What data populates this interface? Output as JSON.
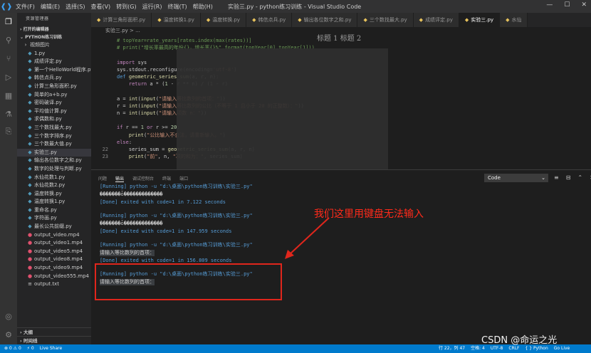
{
  "titlebar": {
    "menu": [
      "文件(F)",
      "编辑(E)",
      "选择(S)",
      "查看(V)",
      "转到(G)",
      "运行(R)",
      "终端(T)",
      "帮助(H)"
    ],
    "title": "实验三.py - python练习训练 - Visual Studio Code"
  },
  "sidebar": {
    "header": "资源管理器",
    "open_editors": "打开的编辑器",
    "folder": "PYTHON练习训练",
    "files": [
      "视频图片",
      "1.py",
      "成绩评定.py",
      "第一个HelloWorld程序.py",
      "韩信点兵.py",
      "计算三角形面积.py",
      "简单的a+b.py",
      "密码破译.py",
      "平均值计算.py",
      "求偶数和.py",
      "三个数找最大.py",
      "三个数字排序.py",
      "三个数最大值.py",
      "实验三.py",
      "输出各位数字之和.py",
      "数字的处理与判断.py",
      "水仙花数1.py",
      "水仙花数2.py",
      "温度转换.py",
      "温度转换1.py",
      "重命名.py",
      "字符画.py",
      "最长公共前缀.py",
      "output_video.mp4",
      "output_video1.mp4",
      "output_video5.mp4",
      "output_video8.mp4",
      "output_video9.mp4",
      "output_video555.mp4",
      "output.txt"
    ],
    "outline": "大纲",
    "timeline": "时间线"
  },
  "tabs": [
    "计算三角形面积.py",
    "温度转换1.py",
    "温度转换.py",
    "韩信点兵.py",
    "输出各位数字之和.py",
    "三个数找最大.py",
    "成绩评定.py",
    "实验三.py",
    "水仙"
  ],
  "breadcrumb": "实验三.py > ...",
  "overlay_tabs": "标题 1   标题 2",
  "editor": {
    "lines": [
      {
        "n": "",
        "code": "# topYear=rate_years[rates.index(max(rates))]"
      },
      {
        "n": "",
        "code": "# print(\"增长率最高的年份{}，增长率{}%\".format(topYear[0],topYear[1]))"
      },
      {
        "n": "",
        "code": ""
      },
      {
        "n": "",
        "code": "import sys"
      },
      {
        "n": "",
        "code": "sys.stdout.reconfigure(encoding='utf-8')"
      },
      {
        "n": "",
        "code": "def geometric_series_sum(a, r, n):"
      },
      {
        "n": "",
        "code": "    return a * (1 - r ** n) / (1 - r)"
      },
      {
        "n": "",
        "code": ""
      },
      {
        "n": "",
        "code": "a = int(input(\"请输入等比数列的首项：\"))"
      },
      {
        "n": "",
        "code": "r = int(input(\"请输入等比数列的公比（不等于 1 且小于 20 的正整数）：\"))"
      },
      {
        "n": "",
        "code": "n = int(input(\"请输入项数 n：\"))"
      },
      {
        "n": "",
        "code": ""
      },
      {
        "n": "",
        "code": "if r == 1 or r >= 20:"
      },
      {
        "n": "",
        "code": "    print(\"公比输入不合法，请重新输入。\")"
      },
      {
        "n": "",
        "code": "else:"
      },
      {
        "n": "22",
        "code": "    series_sum = geometric_series_sum(a, r, n)"
      },
      {
        "n": "23",
        "code": "    print(\"前\", n, \"项的和为：\", series_sum)"
      }
    ]
  },
  "panel": {
    "tabs": [
      "问题",
      "输出",
      "调试控制台",
      "终端",
      "端口"
    ],
    "active_tab": "输出",
    "select": "Code",
    "output": [
      {
        "kind": "run",
        "text": "[Running] python -u \"d:\\桌面\\python练习训练\\实验三.py\""
      },
      {
        "kind": "txt",
        "text": "�������ȱ�������������"
      },
      {
        "kind": "done",
        "text": "[Done] exited with code=1 in 7.122 seconds"
      },
      {
        "kind": "blank",
        "text": ""
      },
      {
        "kind": "run",
        "text": "[Running] python -u \"d:\\桌面\\python练习训练\\实验三.py\""
      },
      {
        "kind": "txt",
        "text": "�������ȱ�������������"
      },
      {
        "kind": "done",
        "text": "[Done] exited with code=1 in 147.959 seconds"
      },
      {
        "kind": "blank",
        "text": ""
      },
      {
        "kind": "run",
        "text": "[Running] python -u \"d:\\桌面\\python练习训练\\实验三.py\""
      },
      {
        "kind": "txt",
        "text": "请输入等比数列的首项："
      },
      {
        "kind": "done",
        "text": "[Done] exited with code=1 in 156.809 seconds"
      },
      {
        "kind": "blank",
        "text": ""
      },
      {
        "kind": "run",
        "text": "[Running] python -u \"d:\\桌面\\python练习训练\\实验三.py\""
      },
      {
        "kind": "txt",
        "text": "请输入等比数列的首项："
      }
    ]
  },
  "annotation": {
    "text": "我们这里用键盘无法输入",
    "color": "#ff2a1a"
  },
  "statusbar": {
    "left": [
      "⊗ 0 ⚠ 0",
      "⚡ 0",
      "Live Share"
    ],
    "right": [
      "行 22，列 47",
      "空格: 4",
      "UTF-8",
      "CRLF",
      "{ } Python",
      "Go Live"
    ]
  },
  "watermark": "CSDN @命运之光"
}
